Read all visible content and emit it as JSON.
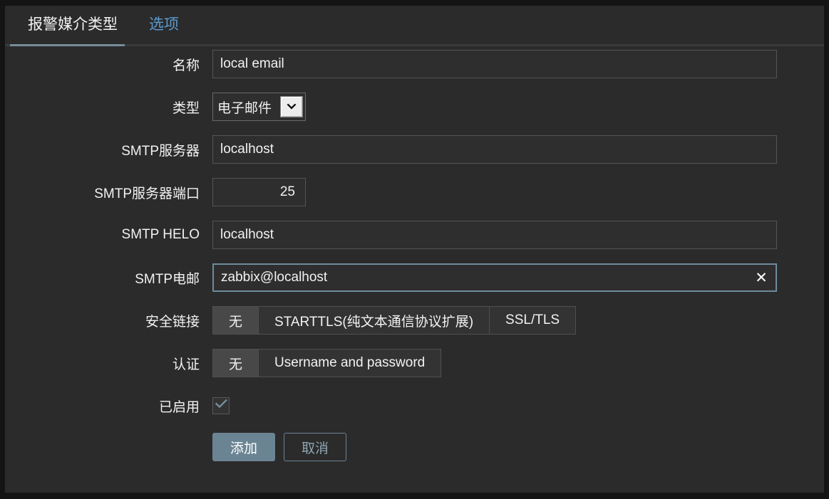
{
  "tabs": [
    {
      "label": "报警媒介类型",
      "active": true
    },
    {
      "label": "选项",
      "active": false
    }
  ],
  "form": {
    "name": {
      "label": "名称",
      "value": "local email",
      "placeholder": ""
    },
    "type": {
      "label": "类型",
      "value": "电子邮件",
      "options": [
        "电子邮件"
      ]
    },
    "smtp_server": {
      "label": "SMTP服务器",
      "value": "localhost",
      "placeholder": ""
    },
    "smtp_port": {
      "label": "SMTP服务器端口",
      "value": "25",
      "placeholder": ""
    },
    "smtp_helo": {
      "label": "SMTP HELO",
      "value": "localhost",
      "placeholder": ""
    },
    "smtp_email": {
      "label": "SMTP电邮",
      "value": "zabbix@localhost",
      "placeholder": "",
      "clear_icon": "close-icon"
    },
    "security": {
      "label": "安全链接",
      "options": [
        {
          "label": "无",
          "selected": true
        },
        {
          "label": "STARTTLS(纯文本通信协议扩展)",
          "selected": false
        },
        {
          "label": "SSL/TLS",
          "selected": false
        }
      ]
    },
    "authentication": {
      "label": "认证",
      "options": [
        {
          "label": "无",
          "selected": true
        },
        {
          "label": "Username and password",
          "selected": false
        }
      ]
    },
    "enabled": {
      "label": "已启用",
      "checked": true,
      "icon": "check-icon"
    }
  },
  "actions": {
    "submit_label": "添加",
    "cancel_label": "取消"
  },
  "colors": {
    "accent": "#6b8493",
    "link": "#5b9bd0",
    "panel_bg": "#2b2b2b",
    "page_bg": "#141414",
    "text": "#f2f2f2"
  }
}
